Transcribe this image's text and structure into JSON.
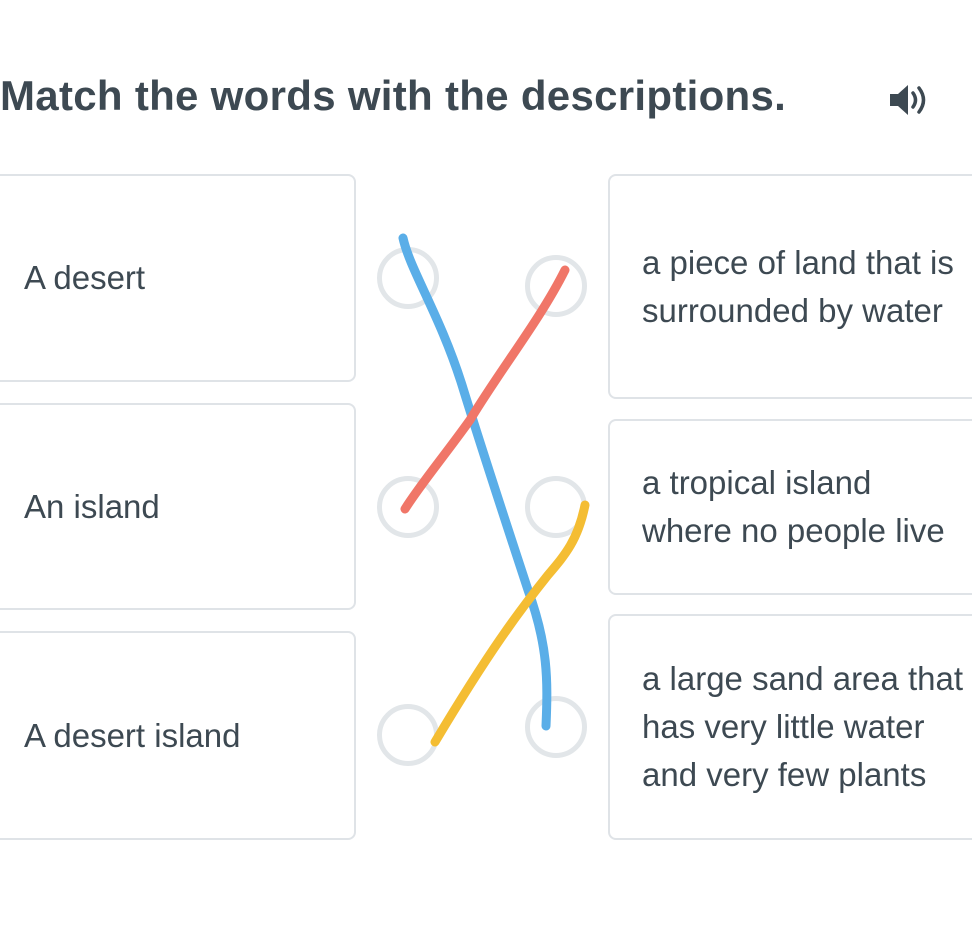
{
  "exercise": {
    "title": "Match the words with the descriptions.",
    "audio_icon": "speaker-icon"
  },
  "left_items": [
    {
      "label": "A desert"
    },
    {
      "label": "An island"
    },
    {
      "label": "A desert island"
    }
  ],
  "right_items": [
    {
      "label": "a piece of land that is surrounded by water"
    },
    {
      "label": "a tropical island where no people live"
    },
    {
      "label": "a large sand area that has very little water and very few plants"
    }
  ],
  "connections": [
    {
      "from": "A desert",
      "to": "a large sand area that has very little water and very few plants",
      "color": "#5aaee8"
    },
    {
      "from": "An island",
      "to": "a piece of land that is surrounded by water",
      "color": "#f07668"
    },
    {
      "from": "A desert island",
      "to": "a tropical island where no people live",
      "color": "#f4bd33"
    }
  ]
}
